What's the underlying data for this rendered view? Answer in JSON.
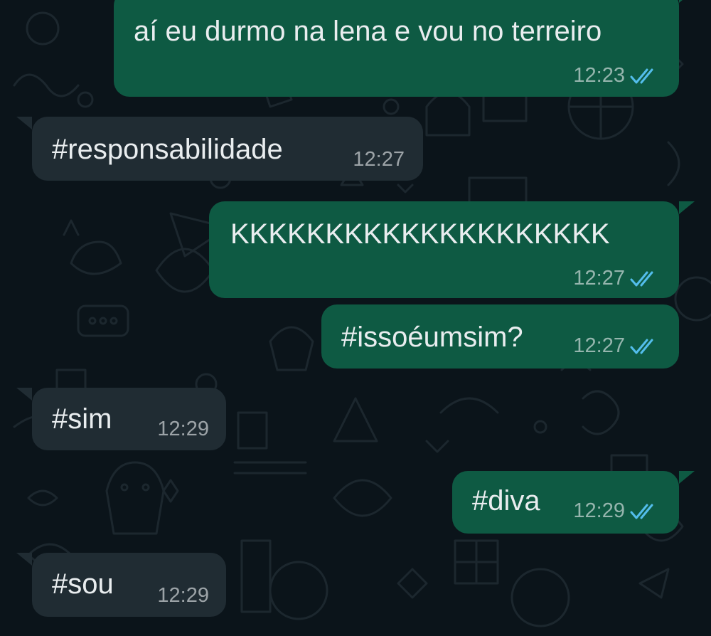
{
  "colors": {
    "background": "#0b141a",
    "outgoing_bubble": "#0e5a43",
    "incoming_bubble": "#202c33",
    "text": "#e9edef",
    "timestamp": "#a8b5ae",
    "read_ticks": "#53bdeb"
  },
  "messages": [
    {
      "direction": "outgoing",
      "text": "aí eu durmo na lena e vou no terreiro",
      "time": "12:23",
      "status": "read",
      "status_icon": "double-check-icon"
    },
    {
      "direction": "incoming",
      "text": "#responsabilidade",
      "time": "12:27"
    },
    {
      "direction": "outgoing",
      "text": "KKKKKKKKKKKKKKKKKKKK",
      "time": "12:27",
      "status": "read",
      "status_icon": "double-check-icon"
    },
    {
      "direction": "outgoing",
      "text": "#issoéumsim?",
      "time": "12:27",
      "status": "read",
      "status_icon": "double-check-icon"
    },
    {
      "direction": "incoming",
      "text": "#sim",
      "time": "12:29"
    },
    {
      "direction": "outgoing",
      "text": "#diva",
      "time": "12:29",
      "status": "read",
      "status_icon": "double-check-icon"
    },
    {
      "direction": "incoming",
      "text": "#sou",
      "time": "12:29"
    }
  ]
}
